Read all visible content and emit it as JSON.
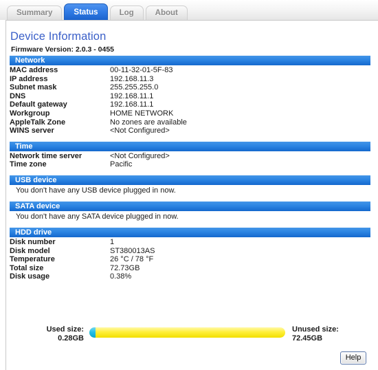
{
  "tabs": [
    {
      "label": "Summary",
      "active": false
    },
    {
      "label": "Status",
      "active": true
    },
    {
      "label": "Log",
      "active": false
    },
    {
      "label": "About",
      "active": false
    }
  ],
  "header": {
    "title": "Device Information",
    "firmware": "Firmware Version: 2.0.3 - 0455"
  },
  "sections": {
    "network": {
      "title": "Network",
      "rows": [
        {
          "label": "MAC address",
          "value": "00-11-32-01-5F-83"
        },
        {
          "label": "IP address",
          "value": "192.168.11.3"
        },
        {
          "label": "Subnet mask",
          "value": "255.255.255.0"
        },
        {
          "label": "DNS",
          "value": "192.168.11.1"
        },
        {
          "label": "Default gateway",
          "value": "192.168.11.1"
        },
        {
          "label": "Workgroup",
          "value": "HOME NETWORK"
        },
        {
          "label": "AppleTalk Zone",
          "value": "No zones are available"
        },
        {
          "label": "WINS server",
          "value": "<Not Configured>"
        }
      ]
    },
    "time": {
      "title": "Time",
      "rows": [
        {
          "label": "Network time server",
          "value": "<Not Configured>"
        },
        {
          "label": "Time zone",
          "value": "Pacific"
        }
      ]
    },
    "usb": {
      "title": "USB device",
      "message": "You don't have any USB device plugged in now."
    },
    "sata": {
      "title": "SATA device",
      "message": "You don't have any SATA device plugged in now."
    },
    "hdd": {
      "title": "HDD drive",
      "rows": [
        {
          "label": "Disk number",
          "value": "1"
        },
        {
          "label": "Disk model",
          "value": "ST380013AS"
        },
        {
          "label": "Temperature",
          "value": "26 °C / 78 °F"
        },
        {
          "label": "Total size",
          "value": "72.73GB"
        },
        {
          "label": "Disk usage",
          "value": "0.38%"
        }
      ]
    }
  },
  "usage_bar": {
    "used_label": "Used size:",
    "used_value": "0.28GB",
    "unused_label": "Unused size:",
    "unused_value": "72.45GB",
    "used_percent": 3.2,
    "used_color": "#22bde4",
    "unused_color": "#ffef3a"
  },
  "footer": {
    "help_label": "Help"
  }
}
